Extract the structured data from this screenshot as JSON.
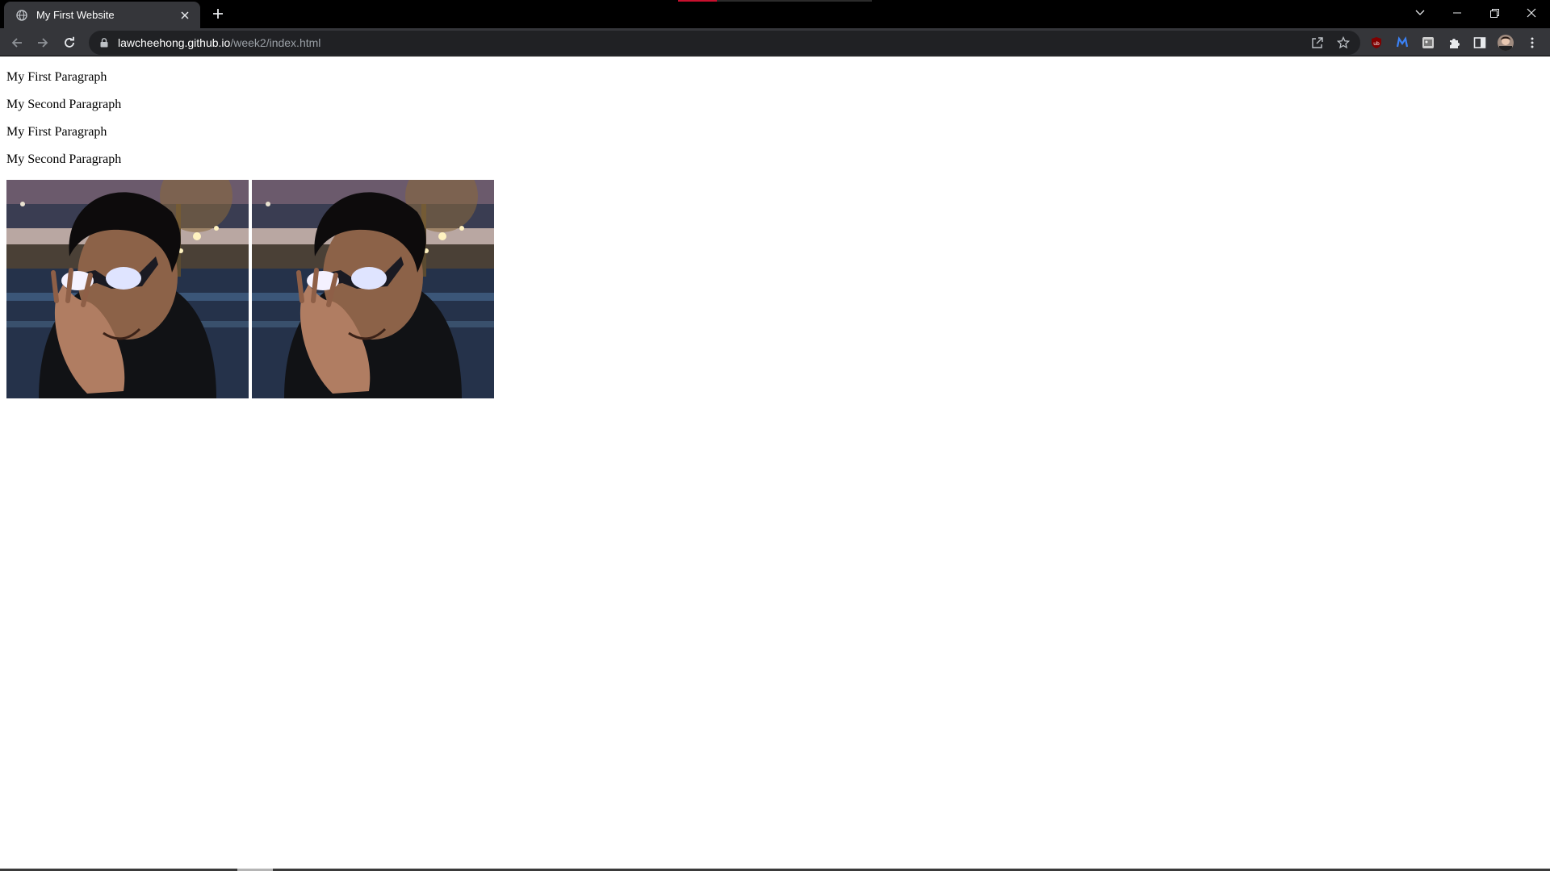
{
  "browser": {
    "tab": {
      "title": "My First Website",
      "favicon": "globe-icon"
    },
    "address_bar": {
      "host": "lawcheehong.github.io",
      "path": "/week2/index.html"
    },
    "icons": {
      "back": "arrow-left-icon",
      "forward": "arrow-right-icon",
      "reload": "reload-icon",
      "share": "share-icon",
      "bookmark": "star-icon",
      "extensions": [
        "ublock-icon",
        "m-extension-icon",
        "photo-extension-icon",
        "puzzle-icon"
      ],
      "side_panel": "side-panel-icon",
      "profile": "avatar",
      "menu": "kebab-menu-icon"
    },
    "window_controls": [
      "tab-search-icon",
      "minimize-icon",
      "restore-icon",
      "close-icon"
    ]
  },
  "page": {
    "paragraphs": [
      "My First Paragraph",
      "My Second Paragraph",
      "My First Paragraph",
      "My Second Paragraph"
    ],
    "images": [
      {
        "subject": "portrait-photo"
      },
      {
        "subject": "portrait-photo"
      }
    ]
  },
  "colors": {
    "titlebar": "#000000",
    "toolbar": "#35363a",
    "omnibox": "#202124",
    "url_path": "#9aa0a6",
    "media_indicator": "#c8102e"
  }
}
